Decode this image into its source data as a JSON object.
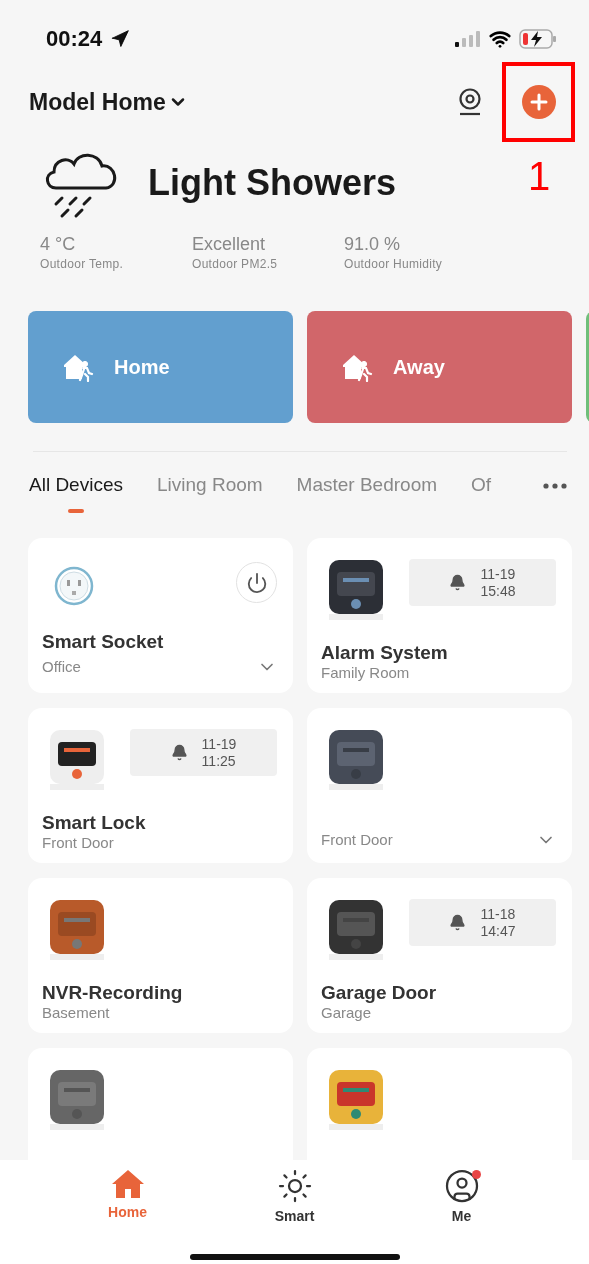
{
  "status_bar": {
    "time": "00:24",
    "battery_low": true
  },
  "header": {
    "home_name": "Model Home",
    "annotation": {
      "label": "1"
    }
  },
  "weather": {
    "condition": "Light Showers",
    "stats": [
      {
        "value": "4 °C",
        "label": "Outdoor Temp."
      },
      {
        "value": "Excellent",
        "label": "Outdoor PM2.5"
      },
      {
        "value": "91.0 %",
        "label": "Outdoor Humidity"
      }
    ]
  },
  "scenes": [
    {
      "label": "Home",
      "color": "#629fcf"
    },
    {
      "label": "Away",
      "color": "#d1666a"
    },
    {
      "color": "#6fbf7a"
    }
  ],
  "room_tabs": [
    {
      "label": "All Devices",
      "selected": true
    },
    {
      "label": "Living Room",
      "selected": false
    },
    {
      "label": "Master Bedroom",
      "selected": false
    },
    {
      "label": "Of",
      "selected": false
    }
  ],
  "devices": [
    {
      "kind": "socket",
      "name": "Smart Socket",
      "room": "Office",
      "power_button": true,
      "expand": true
    },
    {
      "kind": "picture",
      "name": "Alarm System",
      "room": "Family Room",
      "alert": {
        "date": "11-19",
        "time": "15:48"
      },
      "expand": false
    },
    {
      "kind": "picture",
      "name": "Smart Lock",
      "room": "Front Door",
      "alert": {
        "date": "11-19",
        "time": "11:25"
      },
      "expand": false
    },
    {
      "kind": "picture",
      "room": "Front Door",
      "expand": true
    },
    {
      "kind": "picture",
      "name": "NVR-Recording",
      "room": "Basement",
      "expand": false
    },
    {
      "kind": "picture",
      "name": "Garage Door",
      "room": "Garage",
      "alert": {
        "date": "11-18",
        "time": "14:47"
      },
      "expand": false
    },
    {
      "kind": "picture",
      "expand": false
    },
    {
      "kind": "picture",
      "expand": false
    }
  ],
  "bottom_nav": [
    {
      "label": "Home",
      "selected": true,
      "badge": false
    },
    {
      "label": "Smart",
      "selected": false,
      "badge": false
    },
    {
      "label": "Me",
      "selected": false,
      "badge": true
    }
  ]
}
